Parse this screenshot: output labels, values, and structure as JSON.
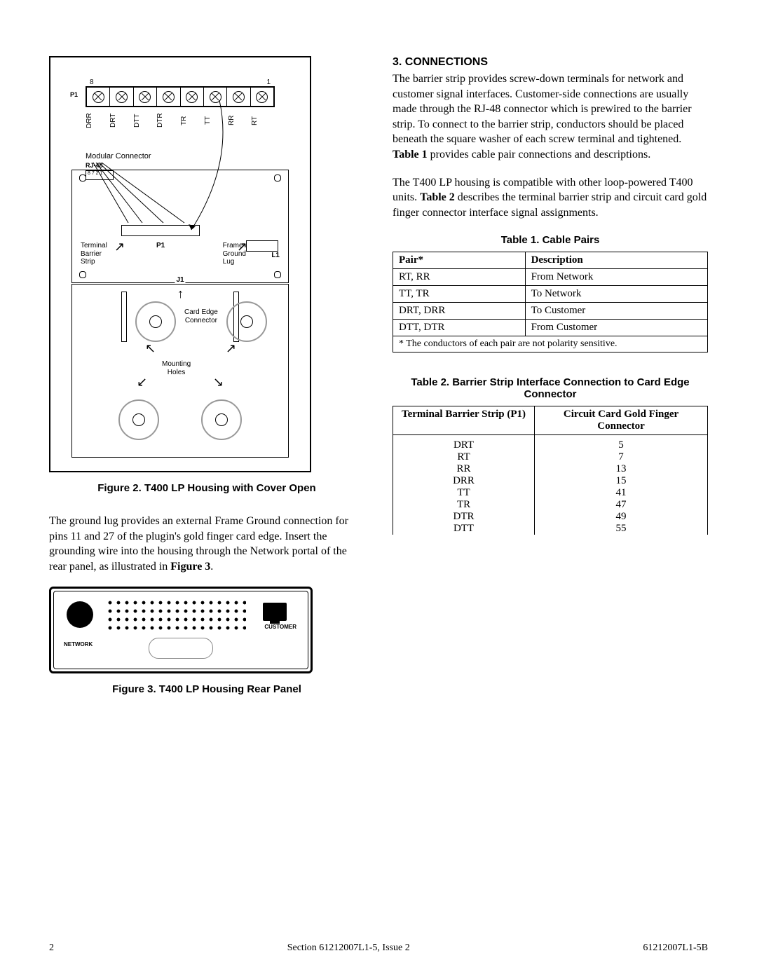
{
  "section": {
    "number": "3.",
    "title": "CONNECTIONS"
  },
  "paragraphs": {
    "p1a": "The barrier strip provides screw-down terminals for network and customer signal interfaces. Customer-side connections are usually made through the RJ-48 connector which is prewired to the barrier strip.  To connect to the barrier strip, conductors should be placed beneath the square washer of each screw terminal and tightened.  ",
    "p1b_bold": "Table 1",
    "p1c": " provides cable pair connections and descriptions.",
    "p2a": "The T400 LP housing is compatible with other loop-powered T400 units.  ",
    "p2b_bold": "Table 2",
    "p2c": " describes the terminal barrier strip and circuit card gold finger connector interface signal assignments.",
    "leftpara_a": "The ground lug provides an external Frame Ground connection for pins 11 and 27 of the plugin's gold finger card edge.  Insert the grounding wire into the housing through the Network portal of the rear panel, as illustrated in ",
    "leftpara_b_bold": "Figure 3",
    "leftpara_c": "."
  },
  "figures": {
    "fig2_caption": "Figure 2.  T400 LP Housing with Cover Open",
    "fig3_caption": "Figure 3.  T400 LP Housing Rear Panel"
  },
  "fig2_labels": {
    "p1": "P1",
    "num8": "8",
    "num1": "1",
    "pins": [
      "DRR",
      "DRT",
      "DTT",
      "DTR",
      "TR",
      "TT",
      "RR",
      "RT"
    ],
    "modular_connector": "Modular Connector",
    "rj48": "RJ-48",
    "rj48_pins": "8 7 2 1",
    "terminal_barrier_strip": "Terminal\nBarrier\nStrip",
    "p1_small": "P1",
    "frame_ground_lug": "Frame\nGround\nLug",
    "l1": "L1",
    "j1": "J1",
    "card_edge_connector": "Card Edge\nConnector",
    "mounting_holes": "Mounting\nHoles"
  },
  "fig3_labels": {
    "network": "NETWORK",
    "customer": "CUSTOMER"
  },
  "tables": {
    "t1": {
      "caption": "Table 1.  Cable Pairs",
      "head": {
        "c1": "Pair*",
        "c2": "Description"
      },
      "rows": [
        {
          "c1": "RT, RR",
          "c2": "From Network"
        },
        {
          "c1": "TT, TR",
          "c2": "To Network"
        },
        {
          "c1": "DRT, DRR",
          "c2": "To Customer"
        },
        {
          "c1": "DTT, DTR",
          "c2": "From Customer"
        }
      ],
      "footnote": "* The conductors of each pair are not polarity sensitive."
    },
    "t2": {
      "caption": "Table 2.  Barrier Strip Interface Connection to Card Edge Connector",
      "head": {
        "c1": "Terminal Barrier Strip (P1)",
        "c2": "Circuit Card Gold Finger Connector"
      },
      "rows": [
        {
          "c1": "DRT",
          "c2": "5"
        },
        {
          "c1": "RT",
          "c2": "7"
        },
        {
          "c1": "RR",
          "c2": "13"
        },
        {
          "c1": "DRR",
          "c2": "15"
        },
        {
          "c1": "TT",
          "c2": "41"
        },
        {
          "c1": "TR",
          "c2": "47"
        },
        {
          "c1": "DTR",
          "c2": "49"
        },
        {
          "c1": "DTT",
          "c2": "55"
        }
      ]
    }
  },
  "footer": {
    "page": "2",
    "center": "Section 61212007L1-5, Issue 2",
    "right": "61212007L1-5B"
  }
}
